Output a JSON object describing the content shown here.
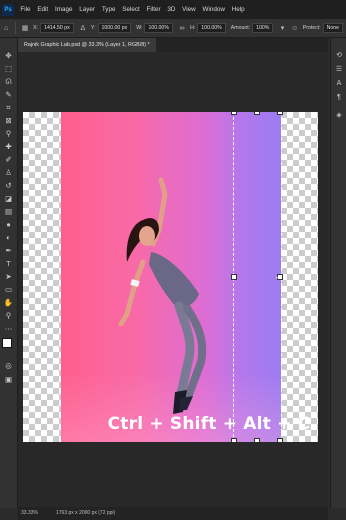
{
  "menubar": {
    "app_logo": "Ps",
    "items": [
      "File",
      "Edit",
      "Image",
      "Layer",
      "Type",
      "Select",
      "Filter",
      "3D",
      "View",
      "Window",
      "Help"
    ]
  },
  "options": {
    "x_label": "X:",
    "x_value": "1414.50 px",
    "y_label": "Y:",
    "y_value": "1000.00 px",
    "w_label": "W:",
    "w_value": "100.00%",
    "h_label": "H:",
    "h_value": "100.00%",
    "amount_label": "Amount:",
    "amount_value": "100%",
    "protect_label": "Protect:",
    "protect_value": "None"
  },
  "document": {
    "tab_title": "Rajnik Graphic Lab.psd @ 33.3% (Layer 1, RGB/8) *"
  },
  "canvas": {
    "overlay_text": "Ctrl + Shift + Alt + C"
  },
  "status": {
    "zoom": "33.33%",
    "doc_info": "1763 px x 2000 px (72 ppi)"
  },
  "icons": {
    "tools": [
      "move-icon",
      "marquee-icon",
      "lasso-icon",
      "quick-select-icon",
      "crop-icon",
      "frame-icon",
      "eyedropper-icon",
      "healing-icon",
      "brush-icon",
      "stamp-icon",
      "history-brush-icon",
      "eraser-icon",
      "gradient-icon",
      "blur-icon",
      "dodge-icon",
      "pen-icon",
      "type-icon",
      "path-select-icon",
      "shape-icon",
      "hand-icon",
      "zoom-icon",
      "more-tools-icon"
    ],
    "right_panel": [
      "history-panel-icon",
      "properties-panel-icon",
      "character-panel-icon",
      "paragraph-panel-icon",
      "layers-panel-icon"
    ]
  }
}
